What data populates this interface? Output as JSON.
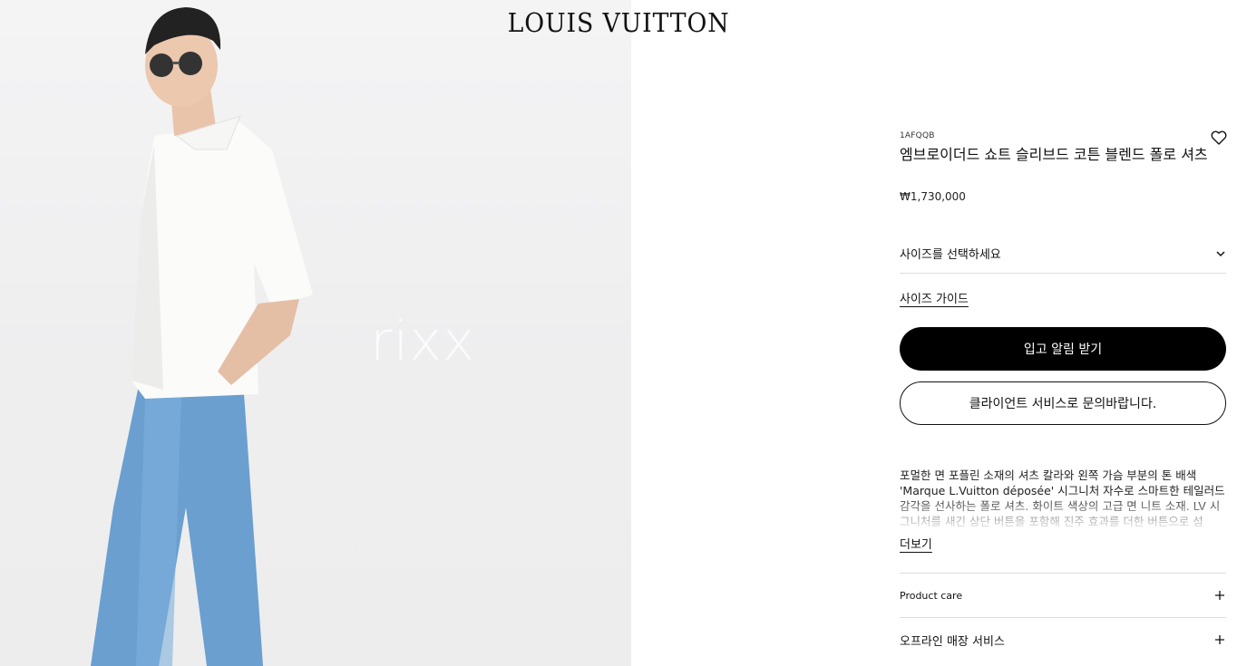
{
  "header": {
    "brand": "LOUIS VUITTON"
  },
  "media": {
    "watermark": "rixx"
  },
  "product": {
    "sku": "1AFQQB",
    "name": "엠브로이더드 쇼트 슬리브드 코튼 블렌드 폴로 셔츠",
    "price": "₩1,730,000"
  },
  "size": {
    "select_label": "사이즈를 선택하세요",
    "guide_label": "사이즈 가이드"
  },
  "actions": {
    "notify": "입고 알림 받기",
    "contact": "클라이언트 서비스로 문의바랍니다."
  },
  "description": {
    "text": "포멀한 면 포플린 소재의 셔츠 칼라와 왼쪽 가슴 부분의 톤 배색 'Marque L.Vuitton déposée' 시그니처 자수로 스마트한 테일러드 감각을 선사하는 폴로 셔츠. 화이트 색상의 고급 면 니트 소재. LV 시그니처를 새긴 상단 버튼을 포함해 진주 효과를 더한 버튼으로 섬",
    "more": "더보기"
  },
  "accordions": [
    {
      "label": "Product care"
    },
    {
      "label": "오프라인 매장 서비스"
    }
  ],
  "icons": {
    "wishlist": "heart-icon",
    "select": "chevron-down-icon",
    "expand": "plus-icon"
  }
}
